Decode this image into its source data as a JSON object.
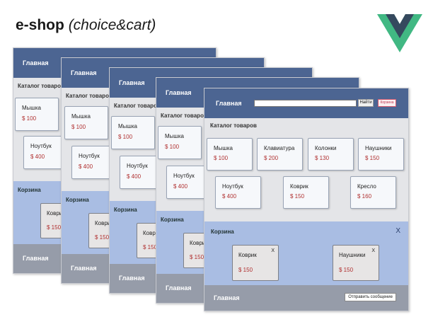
{
  "slide": {
    "title_bold": "e-shop",
    "title_italic": "(choice&cart)"
  },
  "logo": {
    "icon": "vue-logo-icon",
    "colors": {
      "outer": "#41b883",
      "inner": "#35495e"
    }
  },
  "common": {
    "header_label": "Главная",
    "catalog_label": "Каталог товаров",
    "cart_label": "Корзина",
    "footer_label": "Главная"
  },
  "screens": [
    {
      "cards": [
        {
          "name": "Мышка",
          "price": "$ 100"
        },
        {
          "name": "Ноутбук",
          "price": "$ 400"
        }
      ],
      "cart_items": [
        {
          "name": "Коврик",
          "price": "$ 150"
        }
      ]
    },
    {
      "cards": [
        {
          "name": "Мышка",
          "price": "$ 100"
        },
        {
          "name": "Ноутбук",
          "price": "$ 400"
        }
      ],
      "cart_items": [
        {
          "name": "Коврик",
          "price": "$ 150"
        }
      ]
    },
    {
      "cards": [
        {
          "name": "Мышка",
          "price": "$ 100"
        },
        {
          "name": "Ноутбук",
          "price": "$ 400"
        }
      ],
      "cart_items": [
        {
          "name": "Коврик",
          "price": "$ 150"
        }
      ]
    },
    {
      "cards": [
        {
          "name": "Мышка",
          "price": "$ 100"
        },
        {
          "name": "Ноутбук",
          "price": "$ 400"
        }
      ],
      "cart_items": [
        {
          "name": "Коврик",
          "price": "$ 150"
        }
      ]
    }
  ],
  "front": {
    "header": {
      "label": "Главная",
      "search_placeholder": "",
      "find_label": "Найти",
      "cart_button_label": "Корзина"
    },
    "catalog_label": "Каталог товаров",
    "products": [
      {
        "name": "Мышка",
        "price": "$ 100"
      },
      {
        "name": "Клавиатура",
        "price": "$ 200"
      },
      {
        "name": "Колонки",
        "price": "$ 130"
      },
      {
        "name": "Наушники",
        "price": "$ 150"
      },
      {
        "name": "Ноутбук",
        "price": "$ 400"
      },
      {
        "name": "Коврик",
        "price": "$ 150"
      },
      {
        "name": "Кресло",
        "price": "$ 160"
      }
    ],
    "cart": {
      "label": "Корзина",
      "close_label": "X",
      "items": [
        {
          "name": "Коврик",
          "price": "$ 150",
          "remove_label": "X"
        },
        {
          "name": "Наушники",
          "price": "$ 150",
          "remove_label": "X"
        }
      ]
    },
    "footer": {
      "label": "Главная",
      "send_label": "Отправить сообщение"
    }
  }
}
